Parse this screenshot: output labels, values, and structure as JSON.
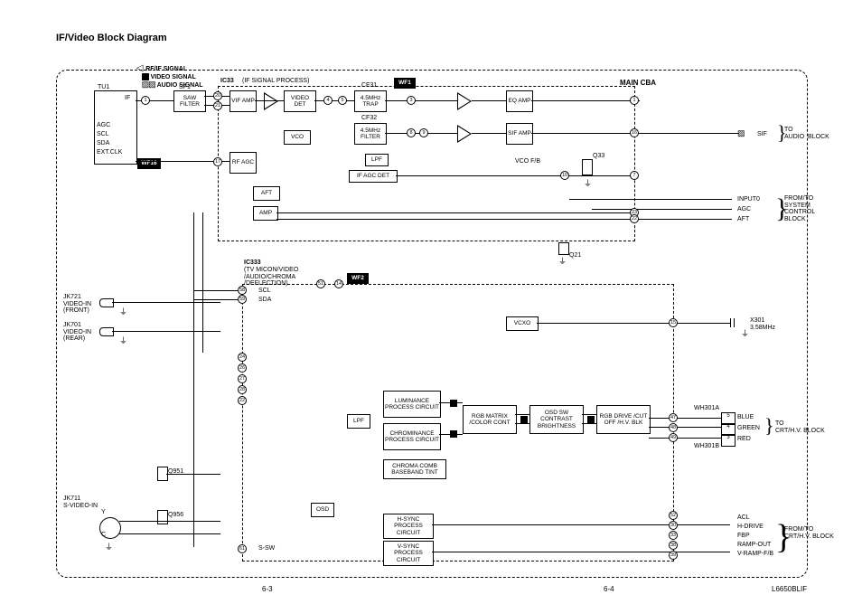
{
  "title": "IF/Video Block Diagram",
  "legend": {
    "rf": "RF/IF SIGNAL",
    "video": "VIDEO SIGNAL",
    "audio": "AUDIO SIGNAL"
  },
  "header": {
    "main_cba": "MAIN CBA",
    "ic33": "IC33",
    "ic33_note": "(IF SIGNAL PROCESS)",
    "ic333": "IC333",
    "ic333_note": "(TV MICON/VIDEO\n/AUDIO/CHROMA\n/DEFLECTION)"
  },
  "top": {
    "tu1": "TU1",
    "if": "IF",
    "agc": "AGC",
    "scl": "SCL",
    "sda": "SDA",
    "extclk": "EXT.CLK",
    "wf16": "WF16",
    "sf1": "SF1",
    "saw": "SAW\nFILTER",
    "vif": "VIF\nAMP",
    "video_det": "VIDEO\nDET",
    "vco": "VCO",
    "rf_agc": "RF\nAGC",
    "aft": "AFT",
    "amp": "AMP",
    "cf31": "CF31",
    "trap": "4.5MHz\nTRAP",
    "cf32": "CF32",
    "filter": "4.5MHz\nFILTER",
    "wf1": "WF1",
    "eq": "EQ\nAMP",
    "sif": "SIF\nAMP",
    "vcofb": "VCO F/B",
    "lpf": "LPF",
    "ifagc": "IF AGC DET",
    "q33": "Q33",
    "q21": "Q21",
    "sif_out": "SIF",
    "to_audio": "TO\nAUDIO  BLOCK",
    "input0": "INPUT0",
    "agc_r": "AGC",
    "aft_r": "AFT",
    "sys": "FROM/TO\nSYSTEM\nCONTROL\nBLOCK"
  },
  "mid": {
    "jk721": "JK721\nVIDEO-IN\n(FRONT)",
    "jk701": "JK701\nVIDEO-IN\n(REAR)",
    "jk711": "JK711\nS-VIDEO-IN",
    "q951": "Q951",
    "q956": "Q956",
    "y": "Y",
    "c": "C",
    "ssw": "S-SW",
    "osd": "OSD",
    "wf2": "WF2",
    "scl": "SCL",
    "sda": "SDA",
    "vcxo": "VCXO",
    "x301": "X301\n3.58MHz"
  },
  "blocks": {
    "lum": "LUMINANCE\nPROCESS\nCIRCUIT",
    "chrom": "CHROMINANCE\nPROCESS\nCIRCUIT",
    "comb": "CHROMA COMB\nBASEBAND  TINT",
    "rgb_matrix": "RGB MATRIX\n/COLOR CONT",
    "osd_sw": "OSD SW\nCONTRAST\nBRIGHTNESS",
    "rgb_drive": "RGB DRIVE\n/CUT OFF\n/H.V. BLK",
    "lpf": "LPF",
    "hsync": "H-SYNC\nPROCESS\nCIRCUIT",
    "vsync": "V-SYNC\nPROCESS\nCIRCUIT"
  },
  "out": {
    "wh301a": "WH301A",
    "wh301b": "WH301B",
    "blue": "BLUE",
    "green": "GREEN",
    "red": "RED",
    "to_crt": "TO\nCRT/H.V. BLOCK",
    "acl": "ACL",
    "hdrive": "H-DRIVE",
    "fbp": "FBP",
    "ramp": "RAMP-OUT",
    "vramp": "V-RAMP-F/B",
    "fromto_crt": "FROM/TO\nCRT/H.V. BLOCK"
  },
  "footer": {
    "left": "6-3",
    "right": "6-4",
    "code": "L6650BLIF"
  },
  "pins_top": {
    "p1": "1",
    "p20": "20",
    "p21": "21",
    "p17": "17",
    "p4": "4",
    "p5": "5",
    "p3": "3",
    "p8": "8",
    "p7": "7",
    "p10": "10",
    "p16": "16",
    "p23": "23",
    "p22": "22",
    "p13": "13",
    "p14": "14",
    "p9": "9"
  },
  "pins_mid": {
    "p58": "58",
    "p59": "59",
    "p51": "51",
    "p14": "14",
    "p15": "15",
    "p24": "24",
    "p26": "26",
    "p27": "27",
    "p28": "28",
    "p22": "22",
    "p61": "61",
    "p47": "47",
    "p48": "48",
    "p49": "49",
    "p52": "52",
    "p53": "53",
    "p54": "54",
    "p30": "30",
    "p33": "33",
    "p34": "34",
    "p38": "38",
    "p39": "39",
    "p5": "5",
    "p4": "4",
    "p3": "3"
  }
}
